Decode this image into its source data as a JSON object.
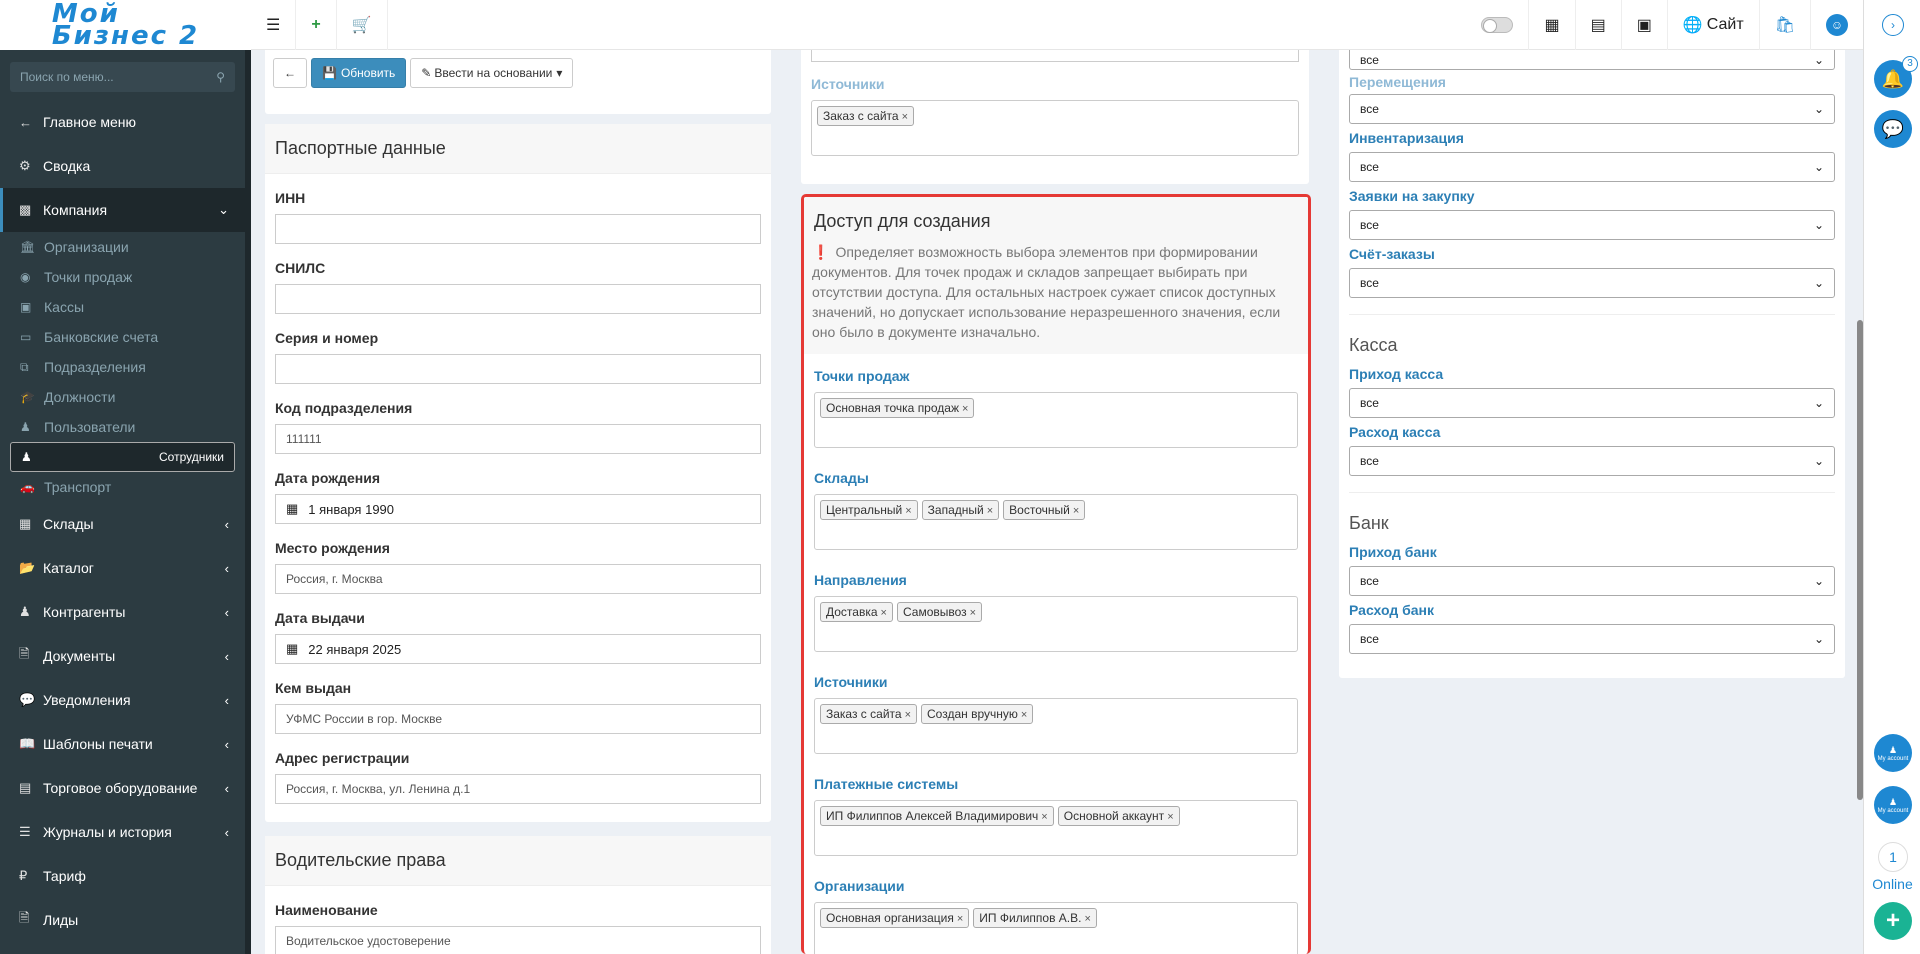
{
  "logo": {
    "line1": "Мой",
    "line2": "Бизнес 2"
  },
  "topbar": {
    "menu_icon": "bars-icon",
    "add_icon": "plus-icon",
    "cart_icon": "cart-icon",
    "site_label": "Сайт"
  },
  "sidebar": {
    "search_placeholder": "Поиск по меню...",
    "main_menu": "Главное меню",
    "summary": "Сводка",
    "company": "Компания",
    "company_sub": [
      "Организации",
      "Точки продаж",
      "Кассы",
      "Банковские счета",
      "Подразделения",
      "Должности",
      "Пользователи",
      "Сотрудники",
      "Транспорт"
    ],
    "rest": [
      "Склады",
      "Каталог",
      "Контрагенты",
      "Документы",
      "Уведомления",
      "Шаблоны печати",
      "Торговое оборудование",
      "Журналы и история",
      "Тариф",
      "Лиды"
    ]
  },
  "toolbar": {
    "refresh": "Обновить",
    "base_on": "Ввести на основании"
  },
  "passport": {
    "title": "Паспортные данные",
    "inn_label": "ИНН",
    "inn_value": "",
    "snils_label": "СНИЛС",
    "snils_value": "",
    "series_label": "Серия и номер",
    "series_value": "",
    "code_label": "Код подразделения",
    "code_value": "111111",
    "birth_label": "Дата рождения",
    "birth_value": "1 января 1990",
    "place_label": "Место рождения",
    "place_value": "Россия, г. Москва",
    "issue_label": "Дата выдачи",
    "issue_value": "22 января 2025",
    "by_label": "Кем выдан",
    "by_value": "УФМС России в гор. Москве",
    "addr_label": "Адрес регистрации",
    "addr_value": "Россия, г. Москва, ул. Ленина д.1"
  },
  "license": {
    "title": "Водительские права",
    "name_label": "Наименование",
    "name_value": "Водительское удостоверение"
  },
  "top_sources": {
    "label": "Источники",
    "tag": "Заказ с сайта"
  },
  "access": {
    "title": "Доступ для создания",
    "note": "Определяет возможность выбора элементов при формировании документов. Для точек продаж и складов запрещает выбирать при отсутствии доступа. Для остальных настроек сужает список доступных значений, но допускает использование неразрешенного значения, если оно было в документе изначально.",
    "points_label": "Точки продаж",
    "points": [
      "Основная точка продаж"
    ],
    "stores_label": "Склады",
    "stores": [
      "Центральный",
      "Западный",
      "Восточный"
    ],
    "dirs_label": "Направления",
    "dirs": [
      "Доставка",
      "Самовывоз"
    ],
    "sources_label": "Источники",
    "sources": [
      "Заказ с сайта",
      "Создан вручную"
    ],
    "pay_label": "Платежные системы",
    "pay": [
      "ИП Филиппов Алексей Владимирович",
      "Основной аккаунт"
    ],
    "orgs_label": "Организации",
    "orgs": [
      "Основная организация",
      "ИП Филиппов А.В."
    ]
  },
  "right": {
    "top_value": "все",
    "moves_label": "Перемещения",
    "moves_value": "все",
    "inv_label": "Инвентаризация",
    "inv_value": "все",
    "req_label": "Заявки на закупку",
    "req_value": "все",
    "inv2_label": "Счёт-заказы",
    "inv2_value": "все",
    "cash_title": "Касса",
    "cash_in_label": "Приход касса",
    "cash_in_value": "все",
    "cash_out_label": "Расход касса",
    "cash_out_value": "все",
    "bank_title": "Банк",
    "bank_in_label": "Приход банк",
    "bank_in_value": "все",
    "bank_out_label": "Расход банк",
    "bank_out_value": "все"
  },
  "rightbar": {
    "badge": "3",
    "online_count": "1",
    "online_label": "Online",
    "account_label": "My account"
  },
  "colors": {
    "accent": "#3c8dbc",
    "highlight_border": "#e53935",
    "sidebar": "#2c3b41"
  }
}
